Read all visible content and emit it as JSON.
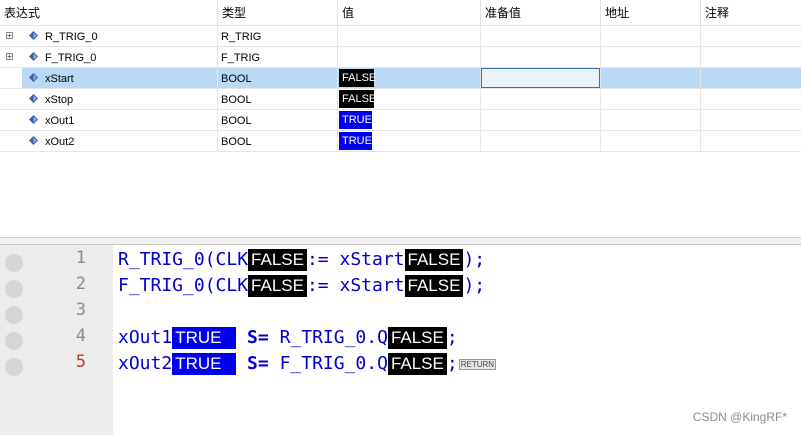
{
  "columns": {
    "expression": "表达式",
    "type": "类型",
    "value": "值",
    "prepared": "准备值",
    "address": "地址",
    "comment": "注释"
  },
  "rows": [
    {
      "name": "R_TRIG_0",
      "type": "R_TRIG",
      "value": "",
      "expandable": true
    },
    {
      "name": "F_TRIG_0",
      "type": "F_TRIG",
      "value": "",
      "expandable": true
    },
    {
      "name": "xStart",
      "type": "BOOL",
      "value": "FALSE",
      "selected": true
    },
    {
      "name": "xStop",
      "type": "BOOL",
      "value": "FALSE"
    },
    {
      "name": "xOut1",
      "type": "BOOL",
      "value": "TRUE"
    },
    {
      "name": "xOut2",
      "type": "BOOL",
      "value": "TRUE"
    }
  ],
  "editor": {
    "line_numbers": [
      "1",
      "2",
      "3",
      "4",
      "5"
    ],
    "line1": {
      "a": "R_TRIG_0(CLK",
      "m1": "FALSE",
      "b": ":= xStart",
      "m2": "FALSE",
      "c": ");"
    },
    "line2": {
      "a": "F_TRIG_0(CLK",
      "m1": "FALSE",
      "b": ":= xStart",
      "m2": "FALSE",
      "c": ");"
    },
    "line4": {
      "a": "xOut1",
      "m1": "TRUE",
      "kw": "S=",
      "b": "R_TRIG_0.Q",
      "m2": "FALSE",
      "c": ";"
    },
    "line5": {
      "a": "xOut2",
      "m1": "TRUE",
      "kw": "S=",
      "b": "F_TRIG_0.Q",
      "m2": "FALSE",
      "c": ";",
      "ret": "RETURN"
    }
  },
  "watermark": "CSDN @KingRF*",
  "colors": {
    "true_bg": "#0000ee",
    "false_bg": "#000000",
    "selection": "#b9d9f5",
    "code_text": "#0000cc"
  }
}
